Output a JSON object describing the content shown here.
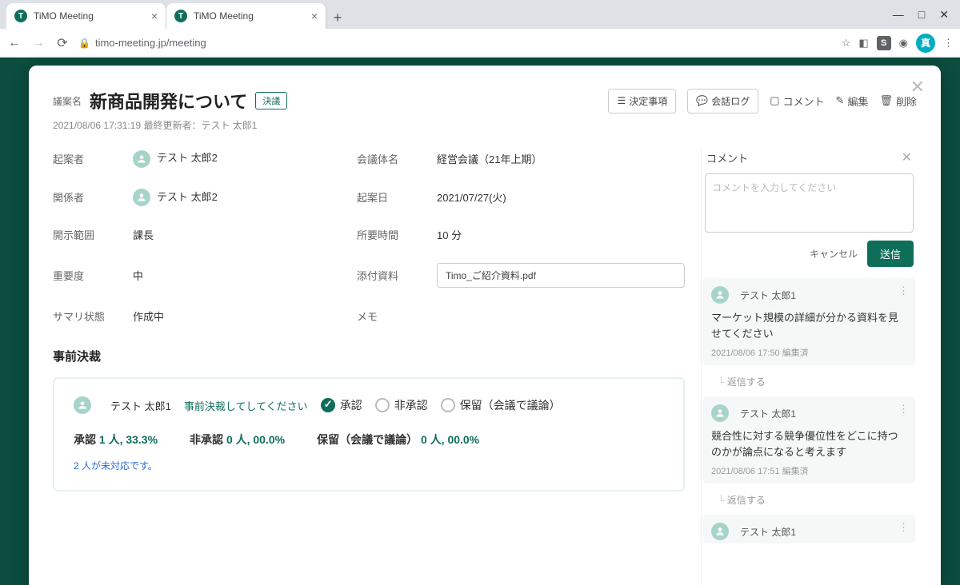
{
  "browser": {
    "tabs": [
      {
        "title": "TiMO Meeting"
      },
      {
        "title": "TiMO Meeting"
      }
    ],
    "url": "timo-meeting.jp/meeting",
    "ext_badge": "S",
    "profile_initial": "真"
  },
  "header": {
    "prefix_label": "議案名",
    "title": "新商品開発について",
    "status_badge": "決議",
    "timestamp": "2021/08/06 17:31:19 最終更新者：テスト 太郎1",
    "buttons": {
      "decisions": "決定事項",
      "call_log": "会話ログ",
      "comment": "コメント",
      "edit": "編集",
      "delete": "削除"
    }
  },
  "details": {
    "labels": {
      "proposer": "起案者",
      "participants": "関係者",
      "disclosure": "開示範囲",
      "importance": "重要度",
      "summary_status": "サマリ状態",
      "meeting_body": "会議体名",
      "proposed_date": "起案日",
      "duration": "所要時間",
      "attachment": "添付資料",
      "memo": "メモ"
    },
    "values": {
      "proposer": "テスト 太郎2",
      "participants": "テスト 太郎2",
      "disclosure": "課長",
      "importance": "中",
      "summary_status": "作成中",
      "meeting_body": "経営会議（21年上期）",
      "proposed_date": "2021/07/27(火)",
      "duration": "10 分",
      "attachment": "Timo_ご紹介資料.pdf"
    }
  },
  "approval": {
    "section_title": "事前決裁",
    "user": "テスト 太郎1",
    "message": "事前決裁してしてください",
    "options": {
      "approve": "承認",
      "reject": "非承認",
      "hold": "保留（会議で議論）"
    },
    "stats": {
      "approve_label": "承認",
      "approve_value": "1 人, 33.3%",
      "reject_label": "非承認",
      "reject_value": "0 人, 00.0%",
      "hold_label": "保留（会議で議論）",
      "hold_value": "0 人, 00.0%"
    },
    "pending_note": "2 人が未対応です。"
  },
  "comments": {
    "panel_title": "コメント",
    "placeholder": "コメントを入力してください",
    "cancel": "キャンセル",
    "send": "送信",
    "reply_label": "返信する",
    "items": [
      {
        "author": "テスト 太郎1",
        "text": "マーケット規模の詳細が分かる資料を見せてください",
        "ts": "2021/08/06 17:50 編集済"
      },
      {
        "author": "テスト 太郎1",
        "text": "競合性に対する競争優位性をどこに持つのかが論点になると考えます",
        "ts": "2021/08/06 17:51 編集済"
      },
      {
        "author": "テスト 太郎1",
        "text": "",
        "ts": ""
      }
    ]
  }
}
